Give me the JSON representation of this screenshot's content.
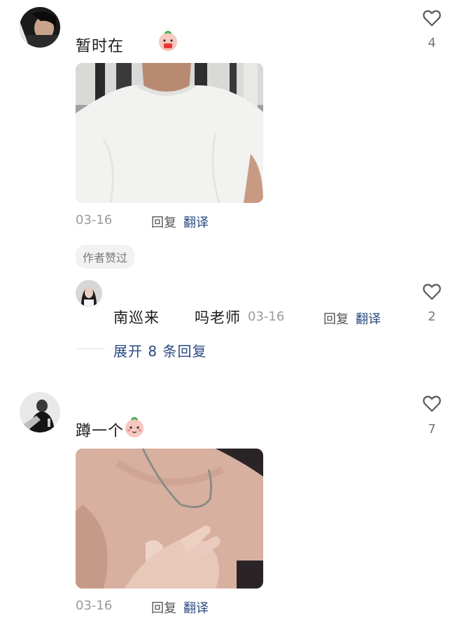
{
  "comments": [
    {
      "text": "暂时在",
      "date": "03-16",
      "reply_label": "回复",
      "translate_label": "翻译",
      "likes": "4",
      "badge": "作者赞过"
    },
    {
      "text": "蹲一个",
      "date": "03-16",
      "reply_label": "回复",
      "translate_label": "翻译",
      "likes": "7"
    }
  ],
  "sub_reply": {
    "user": "南巡来",
    "text": "吗老师",
    "date": "03-16",
    "reply_label": "回复",
    "translate_label": "翻译",
    "likes": "2"
  },
  "expand_label": "展开 8 条回复",
  "colors": {
    "link": "#2a4a7f",
    "meta": "#9a9a9a"
  }
}
